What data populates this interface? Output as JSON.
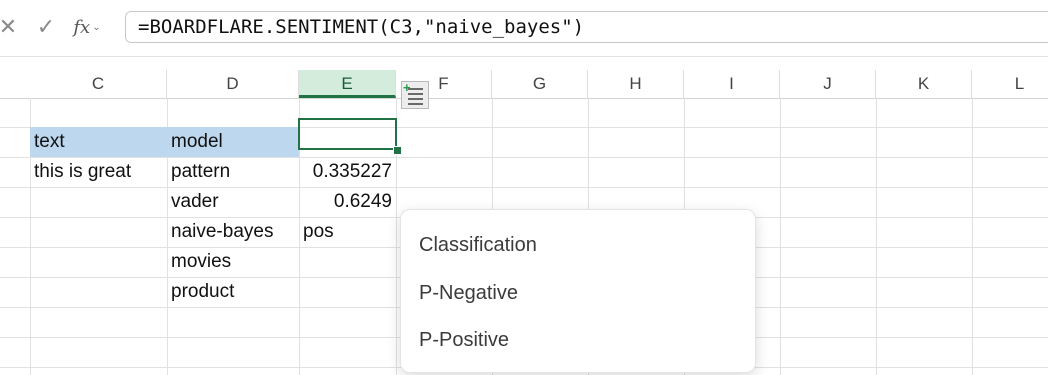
{
  "formula_bar": {
    "cancel_icon": "cancel-x-icon",
    "enter_icon": "enter-check-icon",
    "fx_label": "fx",
    "formula": "=BOARDFLARE.SENTIMENT(C3,\"naive_bayes\")"
  },
  "columns": [
    "C",
    "D",
    "E",
    "F",
    "G",
    "H",
    "I",
    "J",
    "K",
    "L"
  ],
  "selected_column": "E",
  "cells": {
    "C2": "text",
    "D2": "model",
    "C3": "this is great",
    "D3": "pattern",
    "E3": "0.335227",
    "D4": "vader",
    "E4": "0.6249",
    "D5": "naive-bayes",
    "E5": "pos",
    "D6": "movies",
    "D7": "product"
  },
  "colors": {
    "header_fill": "#bdd7ee",
    "accent_green": "#217346",
    "selected_col_bg": "#d3ecdb"
  },
  "autocomplete": {
    "items": [
      "Classification",
      "P-Negative",
      "P-Positive"
    ]
  }
}
